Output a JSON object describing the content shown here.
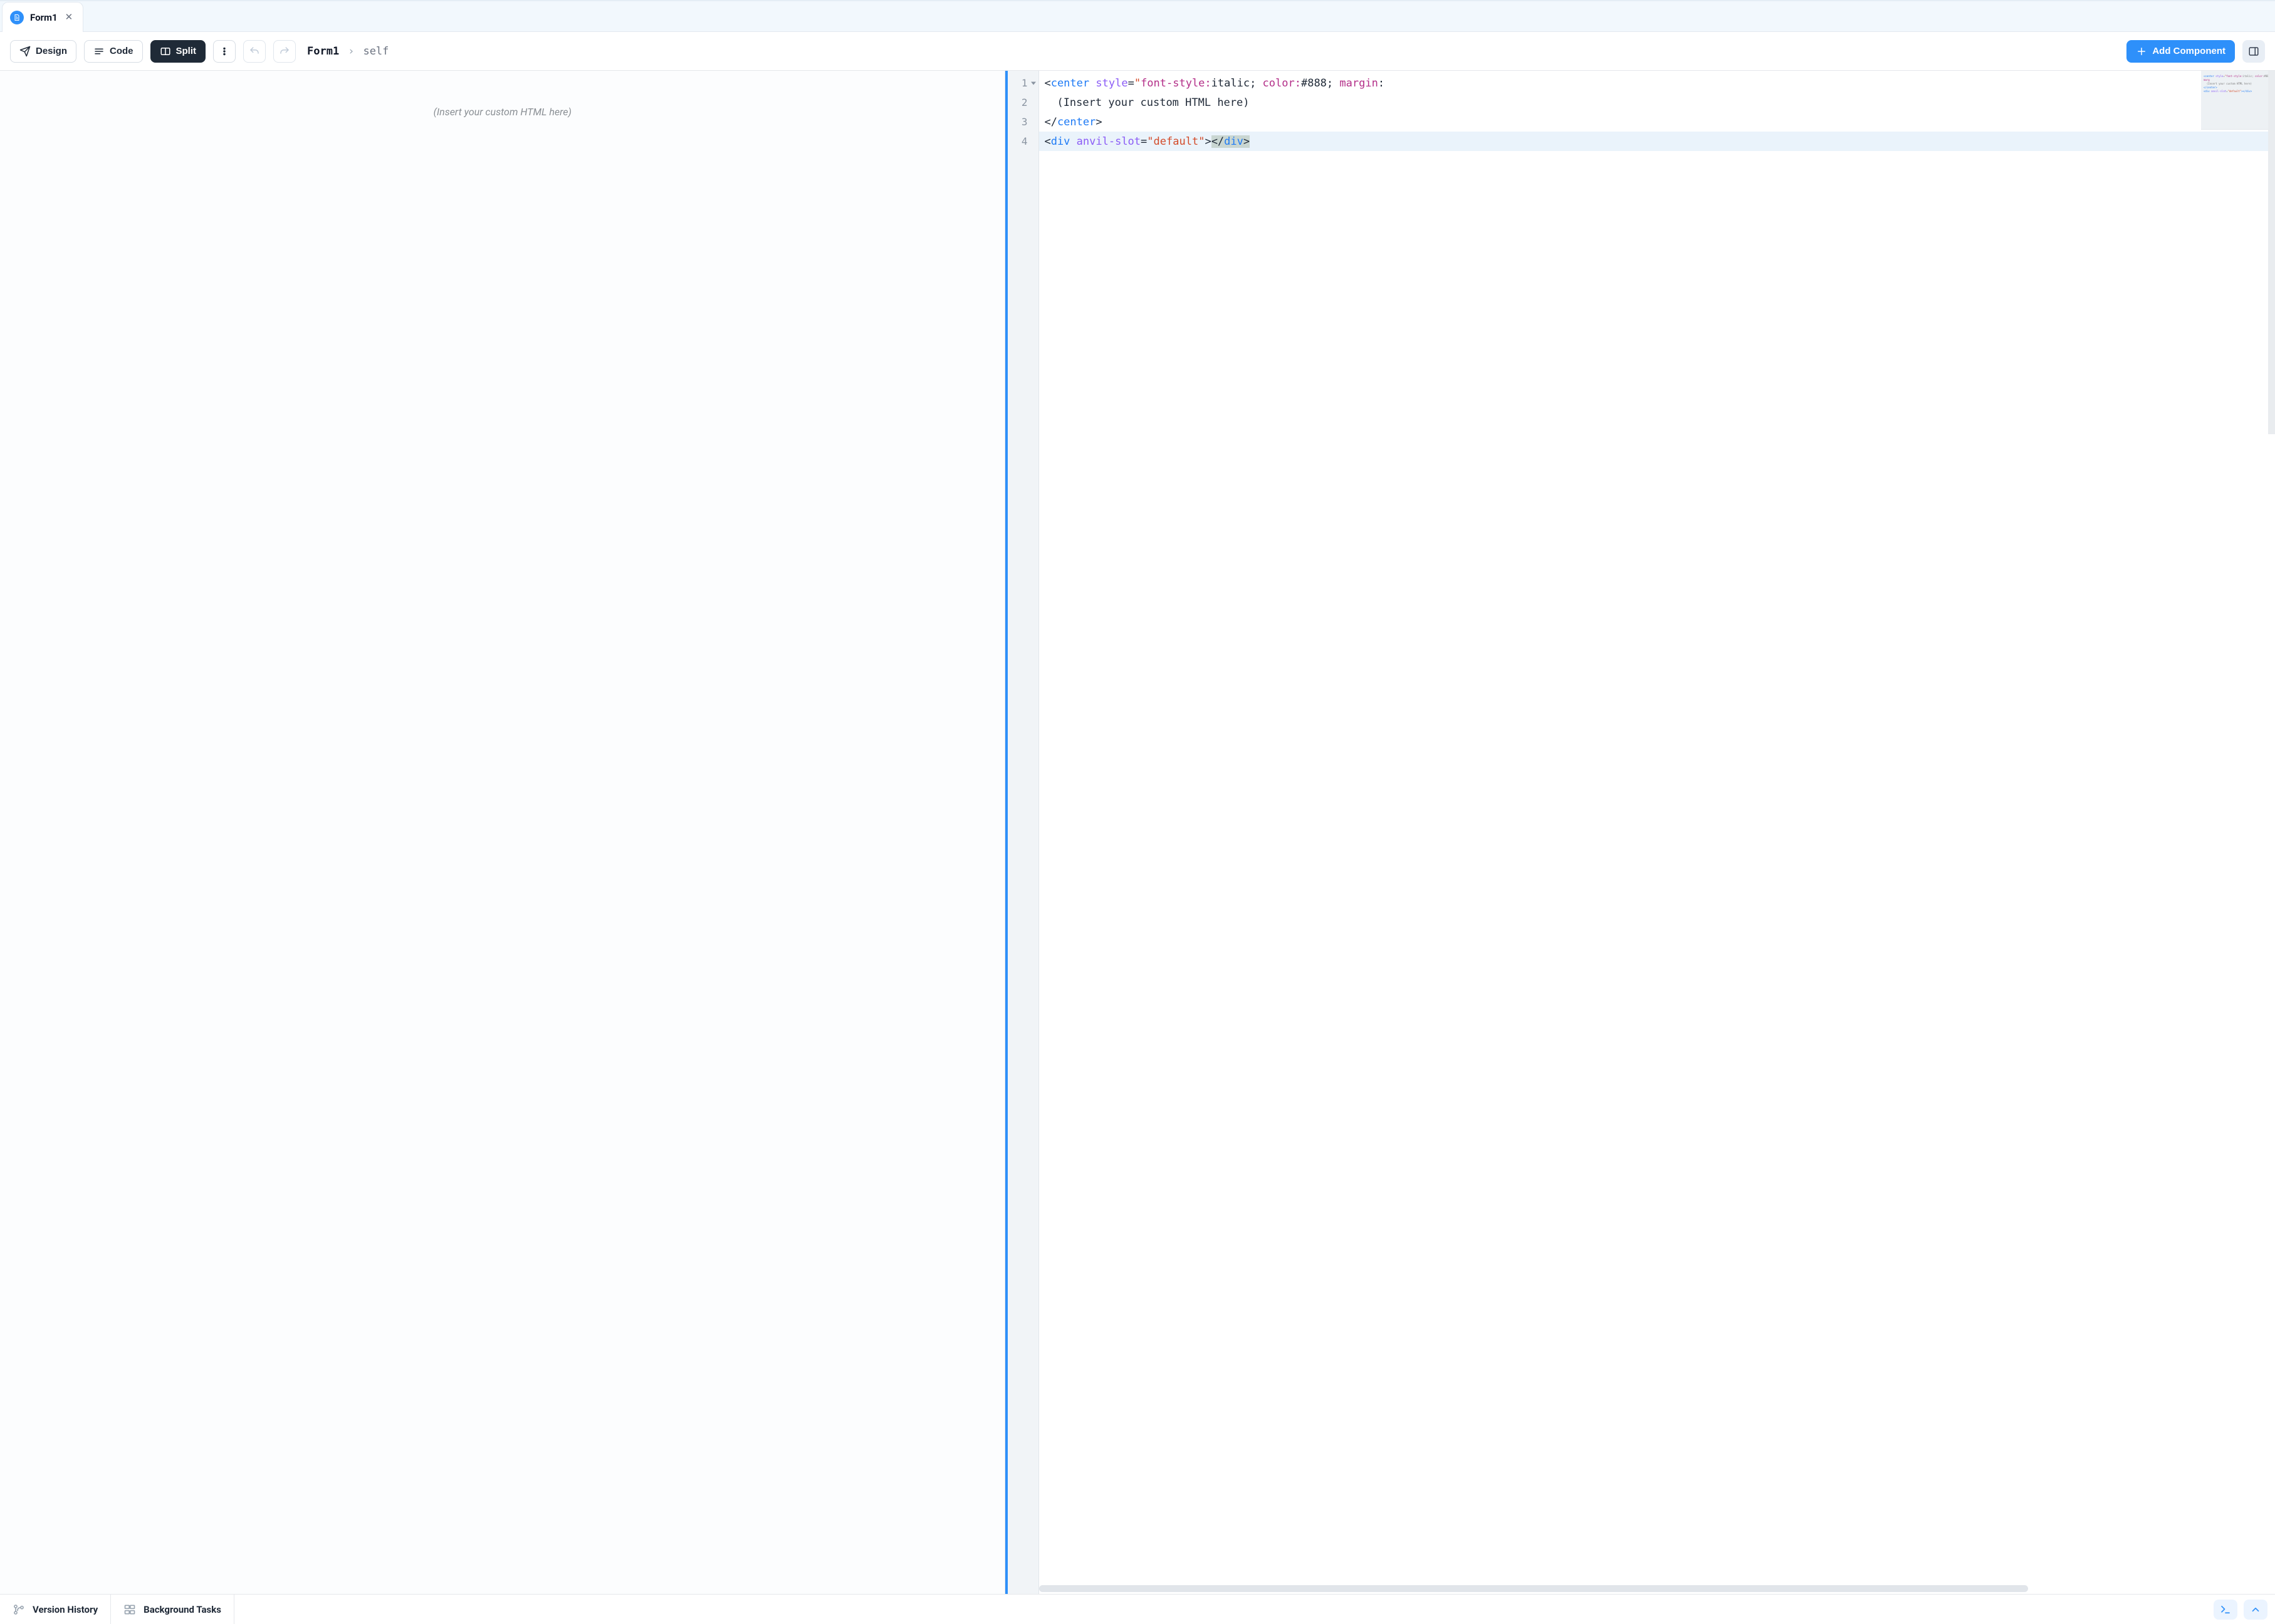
{
  "tab": {
    "title": "Form1"
  },
  "toolbar": {
    "design": "Design",
    "code": "Code",
    "split": "Split",
    "add_component": "Add Component"
  },
  "breadcrumb": {
    "root": "Form1",
    "leaf": "self"
  },
  "preview": {
    "placeholder": "(Insert your custom HTML here)"
  },
  "editor": {
    "line_numbers": [
      "1",
      "2",
      "3",
      "4"
    ],
    "code_raw": "<center style=\"font-style:italic; color:#888; margin:\n  (Insert your custom HTML here)\n</center>\n<div anvil-slot=\"default\"></div>",
    "tokens": {
      "l1": {
        "open": "<",
        "tag": "center",
        "sp": " ",
        "attr": "style",
        "eq": "=",
        "q1": "\"",
        "p1": "font-style:",
        "v1": "italic; ",
        "p2": "color:",
        "v2": "#888; ",
        "p3": "margin",
        "colon": ":"
      },
      "l2": {
        "text": "(Insert your custom HTML here)"
      },
      "l3": {
        "open": "</",
        "tag": "center",
        "close": ">"
      },
      "l4": {
        "open1": "<",
        "tag1": "div",
        "sp": " ",
        "attr": "anvil-slot",
        "eq": "=",
        "q1": "\"",
        "val": "default",
        "q2": "\"",
        "gt1": ">",
        "open2": "</",
        "tag2": "div",
        "gt2": ">"
      }
    }
  },
  "bottombar": {
    "version_history": "Version History",
    "background_tasks": "Background Tasks"
  }
}
